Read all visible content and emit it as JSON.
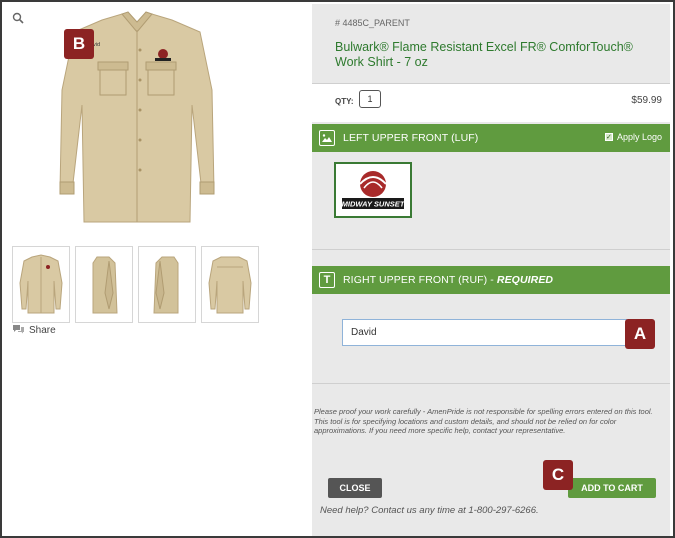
{
  "product": {
    "sku": "# 4485C_PARENT",
    "title": "Bulwark® Flame Resistant Excel FR® ComforTouch® Work Shirt - 7 oz",
    "qty_label": "QTY:",
    "qty_value": "1",
    "price": "$59.99",
    "shirt_text": "David"
  },
  "gallery": {
    "share_label": "Share",
    "thumbnail_count": 4
  },
  "sections": {
    "luf": {
      "label": "LEFT UPPER FRONT (LUF)",
      "apply_logo_label": "Apply Logo",
      "apply_logo_checked": true,
      "logo_text": "MIDWAY SUNSET"
    },
    "ruf": {
      "label": "RIGHT UPPER FRONT (RUF) - ",
      "required_label": "REQUIRED",
      "input_value": "David"
    }
  },
  "disclaimer": "Please proof your work carefully - AmenPride is not responsible for spelling errors entered on this tool. This tool is for specifying locations and custom details, and should not be relied on for color approximations. If you need more specific help, contact your representative.",
  "footer": {
    "close_label": "CLOSE",
    "add_to_cart_label": "ADD TO CART",
    "help_text": "Need help? Contact us any time at 1-800-297-6266."
  },
  "annotations": {
    "a": "A",
    "b": "B",
    "c": "C"
  },
  "colors": {
    "accent_green": "#609b3f",
    "title_green": "#2e7a2e",
    "badge_red": "#8c2323",
    "panel_gray": "#e9e9e9"
  }
}
